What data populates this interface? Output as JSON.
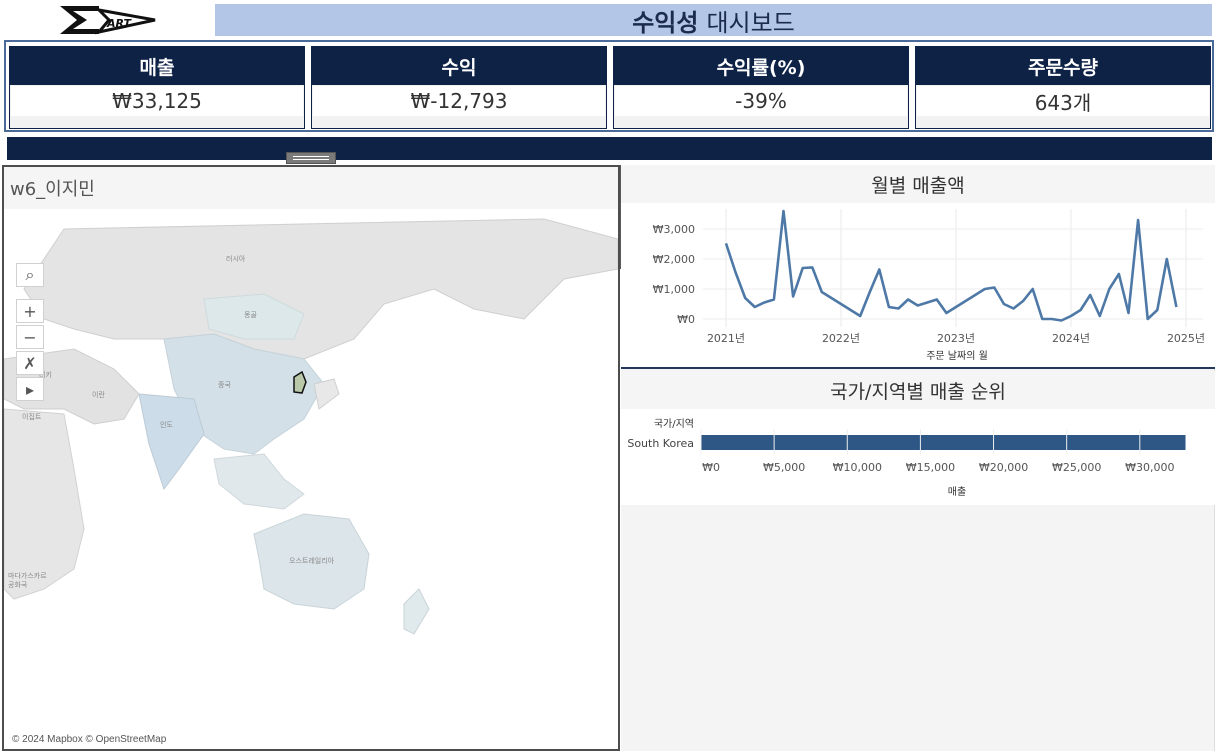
{
  "header": {
    "logo_alt": "DART",
    "title_bold": "수익성",
    "title_rest": "대시보드"
  },
  "kpis": [
    {
      "label": "매출",
      "value": "₩33,125"
    },
    {
      "label": "수익",
      "value": "₩-12,793"
    },
    {
      "label": "수익률(%)",
      "value": "-39%"
    },
    {
      "label": "주문수량",
      "value": "643개"
    }
  ],
  "map": {
    "title": "w6_이지민",
    "attribution": "© 2024 Mapbox © OpenStreetMap",
    "place_labels": [
      "러시아",
      "몽골",
      "중국",
      "인도",
      "이란",
      "터키",
      "이집트",
      "오스트레일리아",
      "마다가스카르",
      "공화국"
    ],
    "highlight_country": "South Korea",
    "tools": [
      "search-icon",
      "zoom-in-icon",
      "zoom-out-icon",
      "clear-selection-icon",
      "play-icon"
    ]
  },
  "side_toolbar": [
    "close-icon",
    "popout-icon",
    "filter-icon",
    "pin-icon",
    "dropdown-icon"
  ],
  "colors": {
    "navy": "#0e2246",
    "title_band": "#b4c6e7",
    "line": "#4e79a7",
    "bar": "#2e5786"
  },
  "line_chart": {
    "title": "월별 매출액",
    "xlabel": "주문 날짜의 월",
    "chart_data": {
      "type": "line",
      "x_ticks": [
        "2021년",
        "2022년",
        "2023년",
        "2024년",
        "2025년"
      ],
      "y_ticks": [
        "₩0",
        "₩1,000",
        "₩2,000",
        "₩3,000"
      ],
      "ylim": [
        0,
        3600
      ],
      "x": [
        "2021-01",
        "2021-02",
        "2021-03",
        "2021-04",
        "2021-05",
        "2021-06",
        "2021-07",
        "2021-08",
        "2021-09",
        "2021-10",
        "2021-11",
        "2021-12",
        "2022-01",
        "2022-02",
        "2022-03",
        "2022-04",
        "2022-05",
        "2022-06",
        "2022-07",
        "2022-08",
        "2022-09",
        "2022-10",
        "2022-11",
        "2022-12",
        "2023-01",
        "2023-02",
        "2023-03",
        "2023-04",
        "2023-05",
        "2023-06",
        "2023-07",
        "2023-08",
        "2023-09",
        "2023-10",
        "2023-11",
        "2023-12",
        "2024-01",
        "2024-02",
        "2024-03",
        "2024-04",
        "2024-05",
        "2024-06",
        "2024-07",
        "2024-08",
        "2024-09",
        "2024-10",
        "2024-11",
        "2024-12"
      ],
      "values": [
        2520,
        1550,
        700,
        400,
        550,
        650,
        3600,
        750,
        1700,
        1720,
        900,
        700,
        500,
        300,
        100,
        900,
        1650,
        400,
        350,
        650,
        450,
        550,
        650,
        200,
        400,
        600,
        800,
        1000,
        1050,
        500,
        350,
        600,
        1000,
        0,
        0,
        -50,
        100,
        300,
        800,
        100,
        1000,
        1500,
        200,
        3300,
        0,
        300,
        2000,
        400
      ]
    }
  },
  "bar_chart": {
    "title": "국가/지역별 매출 순위",
    "row_header": "국가/지역",
    "xlabel": "매출",
    "chart_data": {
      "type": "bar",
      "categories": [
        "South Korea"
      ],
      "values": [
        33125
      ],
      "x_ticks": [
        "₩0",
        "₩5,000",
        "₩10,000",
        "₩15,000",
        "₩20,000",
        "₩25,000",
        "₩30,000"
      ],
      "xlim": [
        0,
        33500
      ]
    }
  }
}
